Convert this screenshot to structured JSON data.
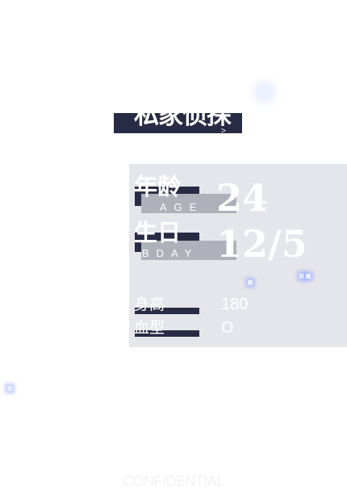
{
  "title": "私家侦探",
  "title_mark": ">",
  "profile": {
    "age": {
      "label": "年龄",
      "label_en": "AGE",
      "value": "24"
    },
    "birthday": {
      "label": "生日",
      "label_en": "BDAY",
      "value": "12/5"
    },
    "height": {
      "label": "身高",
      "value": "180"
    },
    "blood_type": {
      "label": "血型",
      "value": "O"
    }
  },
  "footer": "CONFIDENTIAL",
  "colors": {
    "background": "#ffffff",
    "card": "#e5e6eb",
    "navy": "#272b43",
    "gray_bar": "#aeb0ba",
    "text": "#ffffff"
  }
}
